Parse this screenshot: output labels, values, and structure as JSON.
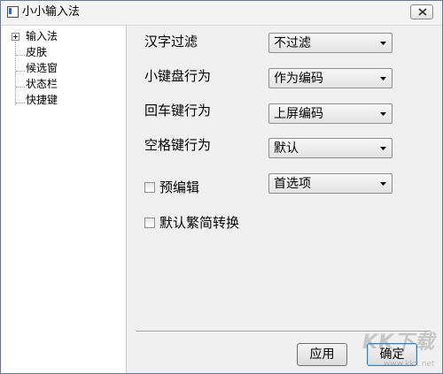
{
  "window": {
    "title": "小小输入法"
  },
  "tree": {
    "items": [
      {
        "label": "输入法",
        "expandable": true
      },
      {
        "label": "皮肤"
      },
      {
        "label": "候选窗"
      },
      {
        "label": "状态栏"
      },
      {
        "label": "快捷键"
      }
    ]
  },
  "settings": {
    "hanzi_filter": {
      "label": "汉字过滤",
      "value": "不过滤"
    },
    "small_keyboard": {
      "label": "小键盘行为",
      "value": "作为编码"
    },
    "enter_key": {
      "label": "回车键行为",
      "value": "上屏编码"
    },
    "space_key": {
      "label": "空格键行为",
      "value": "默认"
    },
    "pre_edit": {
      "label": "预编辑",
      "checked": false,
      "value": "首选项"
    },
    "default_trad_simp": {
      "label": "默认繁简转换",
      "checked": false
    }
  },
  "buttons": {
    "apply": "应用",
    "ok": "确定"
  },
  "watermark": {
    "text": "KK下载",
    "sub": "www.kkx.net"
  }
}
